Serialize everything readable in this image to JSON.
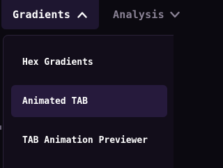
{
  "nav": {
    "gradients_label": "Gradients",
    "gradients_icon": "chevron-up-icon",
    "analysis_label": "Analysis",
    "analysis_icon": "chevron-down-icon"
  },
  "dropdown": {
    "items": [
      {
        "label": "Hex Gradients",
        "active": false
      },
      {
        "label": "Animated TAB",
        "active": true
      },
      {
        "label": "TAB Animation Previewer",
        "active": false
      }
    ]
  },
  "colors": {
    "background": "#0b0910",
    "active_tab": "#1e1630",
    "active_item": "#261a3c",
    "muted_text": "#8a8295",
    "text": "#ffffff"
  }
}
